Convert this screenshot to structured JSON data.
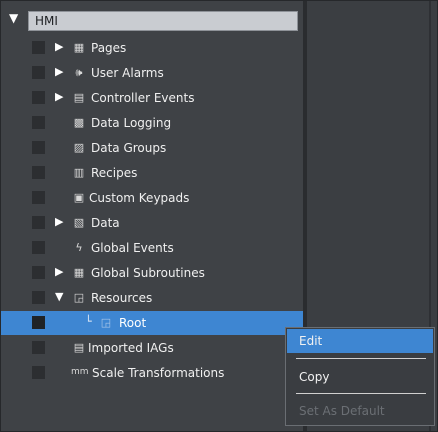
{
  "tree": {
    "root_label": "HMI",
    "items": [
      {
        "label": "Pages",
        "icon": "pages-icon",
        "expander": "collapsed"
      },
      {
        "label": "User Alarms",
        "icon": "speaker-icon",
        "expander": "collapsed"
      },
      {
        "label": "Controller Events",
        "icon": "controller-events-icon",
        "expander": "collapsed"
      },
      {
        "label": "Data Logging",
        "icon": "data-logging-icon",
        "expander": "none"
      },
      {
        "label": "Data Groups",
        "icon": "data-groups-icon",
        "expander": "none"
      },
      {
        "label": "Recipes",
        "icon": "recipes-icon",
        "expander": "none"
      },
      {
        "label": "Custom Keypads",
        "icon": "keypad-icon",
        "expander": "none"
      },
      {
        "label": "Data",
        "icon": "data-icon",
        "expander": "collapsed"
      },
      {
        "label": "Global Events",
        "icon": "lightning-icon",
        "expander": "none"
      },
      {
        "label": "Global Subroutines",
        "icon": "subroutine-icon",
        "expander": "collapsed"
      },
      {
        "label": "Resources",
        "icon": "resources-icon",
        "expander": "expanded"
      },
      {
        "label": "Root",
        "icon": "folder-icon",
        "expander": "child"
      },
      {
        "label": "Imported IAGs",
        "icon": "iags-icon",
        "expander": "none"
      },
      {
        "label": "Scale Transformations",
        "icon": "scale-icon",
        "expander": "none"
      }
    ]
  },
  "context_menu": {
    "items": [
      {
        "label": "Edit",
        "state": "highlighted"
      },
      {
        "label": "Copy",
        "state": "normal"
      },
      {
        "label": "Set As Default",
        "state": "disabled"
      }
    ]
  },
  "colors": {
    "background": "#3f4246",
    "selection": "#3e86d2",
    "header": "#c9ccd1"
  }
}
